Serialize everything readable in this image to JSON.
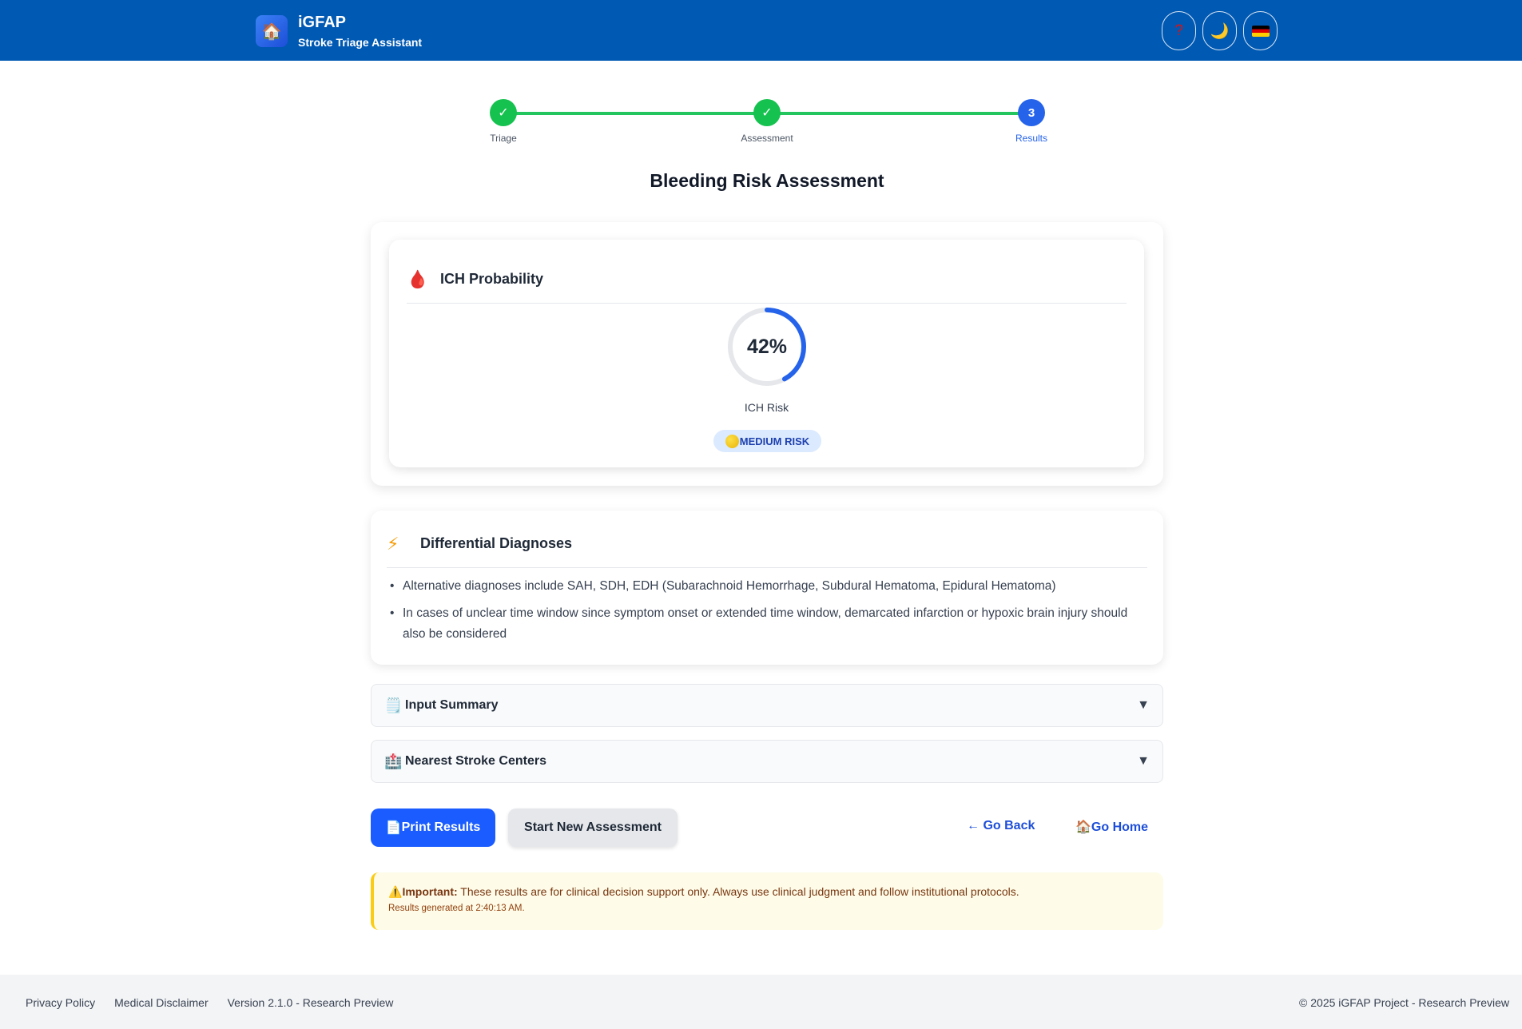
{
  "header": {
    "icon": "house-icon",
    "title": "iGFAP",
    "subtitle": "Stroke Triage Assistant",
    "help_symbol": "?",
    "theme_symbol": "🌙",
    "language_flag": "german-flag-icon"
  },
  "stepper": {
    "steps": [
      {
        "label": "Triage",
        "status": "done",
        "mark": "✓"
      },
      {
        "label": "Assessment",
        "status": "done",
        "mark": "✓"
      },
      {
        "label": "Results",
        "status": "current",
        "mark": "3"
      }
    ],
    "done_color": "#16c24f",
    "current_color": "#2563eb"
  },
  "page_title": "Bleeding Risk Assessment",
  "ich": {
    "icon": "🩸",
    "title": "ICH Probability",
    "percent_text": "42%",
    "percent": 42,
    "label": "ICH Risk",
    "risk_badge": "MEDIUM RISK",
    "gauge_color": "#2563eb"
  },
  "differential": {
    "icon": "⚡",
    "title": "Differential Diagnoses",
    "items": [
      "Alternative diagnoses include SAH, SDH, EDH (Subarachnoid Hemorrhage, Subdural Hematoma, Epidural Hematoma)",
      "In cases of unclear time window since symptom onset or extended time window, demarcated infarction or hypoxic brain injury should also be considered"
    ]
  },
  "accordions": [
    {
      "icon": "🗒️",
      "label": "Input Summary",
      "chevron": "▼"
    },
    {
      "icon": "🏥",
      "label": "Nearest Stroke Centers",
      "chevron": "▼"
    }
  ],
  "actions": {
    "print_icon": "📄",
    "print_label": "Print Results",
    "new_label": "Start New Assessment",
    "back_label": "← Go Back",
    "home_icon": "🏠",
    "home_label": "Go Home"
  },
  "warning": {
    "icon": "⚠️",
    "strong": "Important:",
    "text": " These results are for clinical decision support only. Always use clinical judgment and follow institutional protocols.",
    "timestamp": "Results generated at 2:40:13 AM."
  },
  "footer": {
    "links": [
      "Privacy Policy",
      "Medical Disclaimer",
      "Version 2.1.0 - Research Preview"
    ],
    "copyright": "© 2025 iGFAP Project - Research Preview"
  }
}
